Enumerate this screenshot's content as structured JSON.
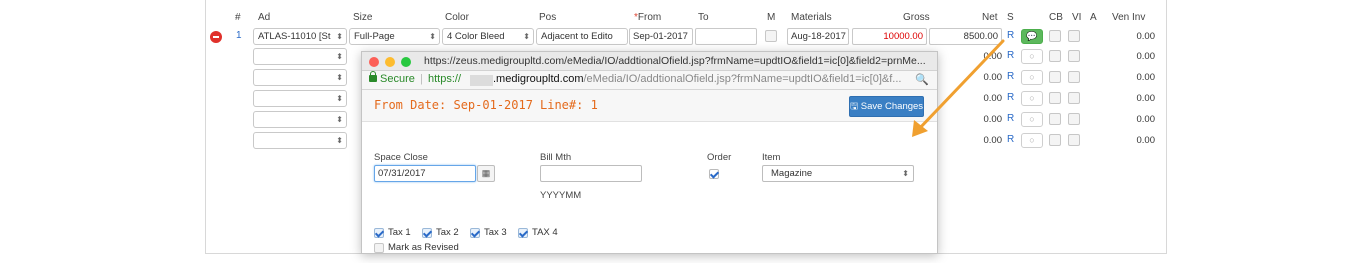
{
  "columns": {
    "hash": "#",
    "ad": "Ad",
    "size": "Size",
    "color": "Color",
    "pos": "Pos",
    "from_star": "*",
    "from": "From",
    "to": "To",
    "m": "M",
    "materials": "Materials",
    "gross": "Gross",
    "net": "Net",
    "s": "S",
    "cb": "CB",
    "vi": "VI",
    "a": "A",
    "ven_inv": "Ven Inv"
  },
  "row1": {
    "line": "1",
    "ad": "ATLAS-11010 [St",
    "size": "Full-Page",
    "color": "4 Color Bleed",
    "pos": "Adjacent to Edito",
    "from": "Sep-01-2017",
    "to": "",
    "materials": "Aug-18-2017",
    "gross": "10000.00",
    "net": "8500.00",
    "r": "R",
    "ven_inv": "0.00"
  },
  "empty_rows": [
    {
      "net": "0.00",
      "r": "R",
      "ven_inv": "0.00"
    },
    {
      "net": "0.00",
      "r": "R",
      "ven_inv": "0.00"
    },
    {
      "net": "0.00",
      "r": "R",
      "ven_inv": "0.00"
    },
    {
      "net": "0.00",
      "r": "R",
      "ven_inv": "0.00"
    },
    {
      "net": "0.00",
      "r": "R",
      "ven_inv": "0.00"
    }
  ],
  "popup": {
    "window_title": "https://zeus.medigroupltd.com/eMedia/IO/addtionalOfield.jsp?frmName=updtIO&field1=ic[0]&field2=prnMe...",
    "secure_label": "Secure",
    "scheme": "https://",
    "url_host": ".medigroupltd.com",
    "url_path": "/eMedia/IO/addtionalOfield.jsp?frmName=updtIO&field1=ic[0]&f...",
    "from_date": "From Date: Sep-01-2017",
    "line_no": "Line#: 1",
    "save_label": "Save Changes",
    "space_close_label": "Space Close",
    "space_close_value": "07/31/2017",
    "bill_mth_label": "Bill Mth",
    "bill_mth_value": "",
    "bill_mth_hint": "YYYYMM",
    "order_label": "Order",
    "item_label": "Item",
    "item_value": "Magazine",
    "tax1": "Tax 1",
    "tax2": "Tax 2",
    "tax3": "Tax 3",
    "tax4": "TAX 4",
    "mark_revised": "Mark as Revised"
  },
  "colors": {
    "accent_orange": "#e46a1c",
    "arrow_orange": "#f0a030",
    "save_blue": "#3a7fc4",
    "delete_red": "#e0312b",
    "gross_red": "#d00000",
    "comment_green": "#5cb85c"
  },
  "icons": [
    "delete-icon",
    "dropdown-arrow-icon",
    "calendar-icon",
    "comment-icon",
    "lock-icon",
    "zoom-icon",
    "save-icon"
  ]
}
